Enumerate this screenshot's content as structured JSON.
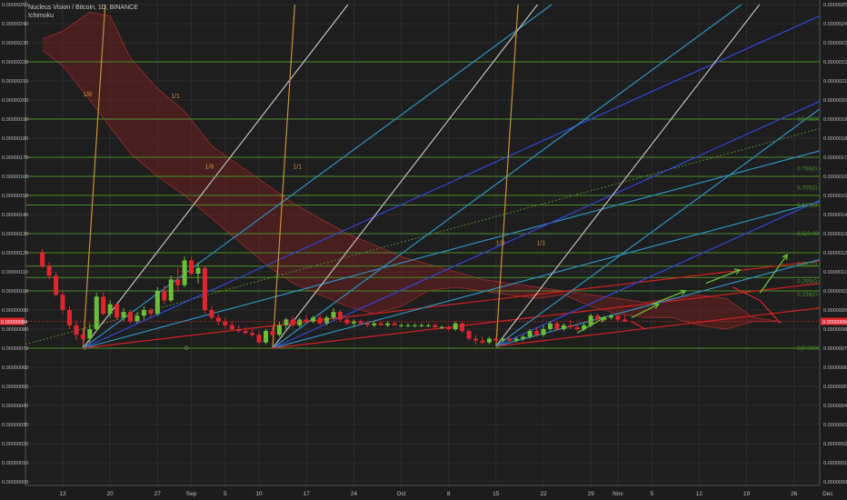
{
  "header": {
    "title": "Nucleus Vision / Bitcoin, 1D, BINANCE",
    "indicator": "Ichimoku"
  },
  "chart_data": {
    "type": "candlestick",
    "ylim": [
      5e-08,
      2.5e-07
    ],
    "y_ticks": [
      "0.00000250",
      "0.00000240",
      "0.00000230",
      "0.00000220",
      "0.00000210",
      "0.00000200",
      "0.00000190",
      "0.00000180",
      "0.00000170",
      "0.00000160",
      "0.00000150",
      "0.00000140",
      "0.00000130",
      "0.00000120",
      "0.00000110",
      "0.00000100",
      "0.00000090",
      "0.00000080",
      "0.00000070",
      "0.00000060",
      "0.00000050",
      "0.00000040",
      "0.00000030",
      "0.00000020",
      "0.00000010",
      "0.00000000"
    ],
    "y_tick_values": [
      250,
      240,
      230,
      220,
      210,
      200,
      190,
      180,
      170,
      160,
      150,
      140,
      130,
      120,
      110,
      100,
      90,
      80,
      70,
      60,
      50,
      40,
      30,
      20,
      10,
      0
    ],
    "price_label": "0.00000084",
    "price_value": 84,
    "x_ticks": [
      "13",
      "20",
      "27",
      "Sep",
      "5",
      "10",
      "17",
      "24",
      "Oct",
      "8",
      "15",
      "22",
      "29",
      "Nov",
      "5",
      "12",
      "19",
      "26",
      "Dec",
      "5"
    ],
    "x_tick_days": [
      0,
      7,
      14,
      19,
      24,
      29,
      36,
      43,
      50,
      57,
      64,
      71,
      78,
      82,
      87,
      94,
      101,
      108,
      113,
      118
    ],
    "horizontal_levels": [
      220,
      190,
      170,
      160,
      150,
      145,
      130,
      120,
      113,
      107,
      100,
      70
    ],
    "fib_labels": [
      {
        "text": "1(0.00000190)",
        "value": 190
      },
      {
        "text": "0.786(0.00",
        "value": 164
      },
      {
        "text": "0.705(0.00",
        "value": 154
      },
      {
        "text": "0.618(0.00",
        "value": 145
      },
      {
        "text": "0.5(0.0000",
        "value": 130
      },
      {
        "text": "0.382(0.00",
        "value": 114
      },
      {
        "text": "0.295(0.00",
        "value": 105
      },
      {
        "text": "0.236(0.00",
        "value": 98
      },
      {
        "text": "0(0.00000",
        "value": 70
      }
    ],
    "fan_labels": [
      {
        "text": "1/8",
        "day": 3,
        "value": 202
      },
      {
        "text": "1/1",
        "day": 16,
        "value": 201
      },
      {
        "text": "1/8",
        "day": 21,
        "value": 164
      },
      {
        "text": "1/1",
        "day": 34,
        "value": 164
      },
      {
        "text": "1/8",
        "day": 64,
        "value": 124
      },
      {
        "text": "1/1",
        "day": 70,
        "value": 124
      }
    ],
    "anchor_labels": [
      {
        "text": "0",
        "day": 3,
        "value": 69
      },
      {
        "text": "0",
        "day": 18,
        "value": 69
      },
      {
        "text": "0",
        "day": 64,
        "value": 70
      }
    ],
    "candles": [
      {
        "d": -3,
        "o": 120,
        "h": 122,
        "l": 112,
        "c": 113
      },
      {
        "d": -2,
        "o": 113,
        "h": 115,
        "l": 106,
        "c": 108
      },
      {
        "d": -1,
        "o": 108,
        "h": 110,
        "l": 97,
        "c": 98
      },
      {
        "d": 0,
        "o": 98,
        "h": 100,
        "l": 88,
        "c": 90
      },
      {
        "d": 1,
        "o": 90,
        "h": 92,
        "l": 80,
        "c": 82
      },
      {
        "d": 2,
        "o": 82,
        "h": 84,
        "l": 74,
        "c": 77
      },
      {
        "d": 3,
        "o": 77,
        "h": 80,
        "l": 72,
        "c": 75
      },
      {
        "d": 4,
        "o": 75,
        "h": 83,
        "l": 73,
        "c": 80
      },
      {
        "d": 5,
        "o": 80,
        "h": 99,
        "l": 79,
        "c": 97
      },
      {
        "d": 6,
        "o": 97,
        "h": 99,
        "l": 87,
        "c": 88
      },
      {
        "d": 7,
        "o": 88,
        "h": 95,
        "l": 86,
        "c": 93
      },
      {
        "d": 8,
        "o": 93,
        "h": 94,
        "l": 85,
        "c": 86
      },
      {
        "d": 9,
        "o": 86,
        "h": 91,
        "l": 84,
        "c": 89
      },
      {
        "d": 10,
        "o": 89,
        "h": 90,
        "l": 83,
        "c": 84
      },
      {
        "d": 11,
        "o": 84,
        "h": 89,
        "l": 83,
        "c": 87
      },
      {
        "d": 12,
        "o": 87,
        "h": 92,
        "l": 85,
        "c": 90
      },
      {
        "d": 13,
        "o": 90,
        "h": 91,
        "l": 86,
        "c": 88
      },
      {
        "d": 14,
        "o": 88,
        "h": 102,
        "l": 87,
        "c": 100
      },
      {
        "d": 15,
        "o": 100,
        "h": 103,
        "l": 93,
        "c": 95
      },
      {
        "d": 16,
        "o": 95,
        "h": 108,
        "l": 94,
        "c": 106
      },
      {
        "d": 17,
        "o": 106,
        "h": 112,
        "l": 100,
        "c": 103
      },
      {
        "d": 18,
        "o": 103,
        "h": 118,
        "l": 102,
        "c": 116
      },
      {
        "d": 19,
        "o": 116,
        "h": 118,
        "l": 108,
        "c": 109
      },
      {
        "d": 20,
        "o": 109,
        "h": 115,
        "l": 104,
        "c": 112
      },
      {
        "d": 21,
        "o": 112,
        "h": 113,
        "l": 88,
        "c": 90
      },
      {
        "d": 22,
        "o": 90,
        "h": 92,
        "l": 85,
        "c": 86
      },
      {
        "d": 23,
        "o": 86,
        "h": 88,
        "l": 82,
        "c": 84
      },
      {
        "d": 24,
        "o": 84,
        "h": 86,
        "l": 80,
        "c": 82
      },
      {
        "d": 25,
        "o": 82,
        "h": 84,
        "l": 79,
        "c": 80
      },
      {
        "d": 26,
        "o": 80,
        "h": 82,
        "l": 78,
        "c": 79
      },
      {
        "d": 27,
        "o": 79,
        "h": 81,
        "l": 77,
        "c": 78
      },
      {
        "d": 28,
        "o": 78,
        "h": 80,
        "l": 76,
        "c": 77
      },
      {
        "d": 29,
        "o": 77,
        "h": 79,
        "l": 72,
        "c": 73
      },
      {
        "d": 30,
        "o": 73,
        "h": 80,
        "l": 72,
        "c": 79
      },
      {
        "d": 31,
        "o": 79,
        "h": 82,
        "l": 76,
        "c": 77
      },
      {
        "d": 32,
        "o": 77,
        "h": 84,
        "l": 76,
        "c": 82
      },
      {
        "d": 33,
        "o": 82,
        "h": 86,
        "l": 80,
        "c": 85
      },
      {
        "d": 34,
        "o": 85,
        "h": 87,
        "l": 81,
        "c": 82
      },
      {
        "d": 35,
        "o": 82,
        "h": 86,
        "l": 81,
        "c": 85
      },
      {
        "d": 36,
        "o": 85,
        "h": 87,
        "l": 83,
        "c": 84
      },
      {
        "d": 37,
        "o": 84,
        "h": 87,
        "l": 83,
        "c": 86
      },
      {
        "d": 38,
        "o": 86,
        "h": 88,
        "l": 82,
        "c": 83
      },
      {
        "d": 39,
        "o": 83,
        "h": 87,
        "l": 82,
        "c": 86
      },
      {
        "d": 40,
        "o": 86,
        "h": 91,
        "l": 85,
        "c": 89
      },
      {
        "d": 41,
        "o": 89,
        "h": 90,
        "l": 84,
        "c": 85
      },
      {
        "d": 42,
        "o": 85,
        "h": 86,
        "l": 82,
        "c": 83
      },
      {
        "d": 43,
        "o": 83,
        "h": 85,
        "l": 81,
        "c": 84
      },
      {
        "d": 44,
        "o": 84,
        "h": 85,
        "l": 82,
        "c": 83
      },
      {
        "d": 45,
        "o": 83,
        "h": 84,
        "l": 81,
        "c": 82
      },
      {
        "d": 46,
        "o": 82,
        "h": 84,
        "l": 81,
        "c": 83
      },
      {
        "d": 47,
        "o": 83,
        "h": 84,
        "l": 82,
        "c": 82
      },
      {
        "d": 48,
        "o": 82,
        "h": 84,
        "l": 81,
        "c": 83
      },
      {
        "d": 49,
        "o": 83,
        "h": 84,
        "l": 82,
        "c": 82
      },
      {
        "d": 50,
        "o": 82,
        "h": 83,
        "l": 81,
        "c": 82
      },
      {
        "d": 51,
        "o": 82,
        "h": 83,
        "l": 81,
        "c": 82
      },
      {
        "d": 52,
        "o": 82,
        "h": 83,
        "l": 81,
        "c": 82
      },
      {
        "d": 53,
        "o": 82,
        "h": 83,
        "l": 81,
        "c": 82
      },
      {
        "d": 54,
        "o": 82,
        "h": 83,
        "l": 81,
        "c": 82
      },
      {
        "d": 55,
        "o": 82,
        "h": 83,
        "l": 80,
        "c": 81
      },
      {
        "d": 56,
        "o": 81,
        "h": 82,
        "l": 80,
        "c": 81
      },
      {
        "d": 57,
        "o": 81,
        "h": 82,
        "l": 79,
        "c": 80
      },
      {
        "d": 58,
        "o": 80,
        "h": 84,
        "l": 79,
        "c": 83
      },
      {
        "d": 59,
        "o": 83,
        "h": 84,
        "l": 78,
        "c": 79
      },
      {
        "d": 60,
        "o": 79,
        "h": 80,
        "l": 74,
        "c": 75
      },
      {
        "d": 61,
        "o": 75,
        "h": 77,
        "l": 72,
        "c": 74
      },
      {
        "d": 62,
        "o": 74,
        "h": 76,
        "l": 72,
        "c": 73
      },
      {
        "d": 63,
        "o": 73,
        "h": 76,
        "l": 72,
        "c": 75
      },
      {
        "d": 64,
        "o": 75,
        "h": 76,
        "l": 73,
        "c": 74
      },
      {
        "d": 65,
        "o": 74,
        "h": 76,
        "l": 73,
        "c": 75
      },
      {
        "d": 66,
        "o": 75,
        "h": 76,
        "l": 73,
        "c": 74
      },
      {
        "d": 67,
        "o": 74,
        "h": 76,
        "l": 73,
        "c": 75
      },
      {
        "d": 68,
        "o": 75,
        "h": 77,
        "l": 74,
        "c": 76
      },
      {
        "d": 69,
        "o": 76,
        "h": 80,
        "l": 75,
        "c": 79
      },
      {
        "d": 70,
        "o": 79,
        "h": 81,
        "l": 76,
        "c": 77
      },
      {
        "d": 71,
        "o": 77,
        "h": 82,
        "l": 76,
        "c": 80
      },
      {
        "d": 72,
        "o": 80,
        "h": 84,
        "l": 79,
        "c": 83
      },
      {
        "d": 73,
        "o": 83,
        "h": 84,
        "l": 79,
        "c": 80
      },
      {
        "d": 74,
        "o": 80,
        "h": 83,
        "l": 79,
        "c": 82
      },
      {
        "d": 75,
        "o": 82,
        "h": 85,
        "l": 80,
        "c": 81
      },
      {
        "d": 76,
        "o": 81,
        "h": 83,
        "l": 79,
        "c": 80
      },
      {
        "d": 77,
        "o": 80,
        "h": 83,
        "l": 79,
        "c": 82
      },
      {
        "d": 78,
        "o": 82,
        "h": 88,
        "l": 81,
        "c": 87
      },
      {
        "d": 79,
        "o": 87,
        "h": 88,
        "l": 84,
        "c": 85
      },
      {
        "d": 80,
        "o": 85,
        "h": 87,
        "l": 84,
        "c": 86
      },
      {
        "d": 81,
        "o": 86,
        "h": 88,
        "l": 85,
        "c": 87
      },
      {
        "d": 82,
        "o": 87,
        "h": 88,
        "l": 84,
        "c": 85
      },
      {
        "d": 83,
        "o": 85,
        "h": 88,
        "l": 84,
        "c": 84
      }
    ],
    "ichimoku_cloud": [
      {
        "d": -3,
        "a": 232,
        "b": 226
      },
      {
        "d": 0,
        "a": 236,
        "b": 218
      },
      {
        "d": 4,
        "a": 246,
        "b": 200
      },
      {
        "d": 7,
        "a": 244,
        "b": 186
      },
      {
        "d": 10,
        "a": 222,
        "b": 172
      },
      {
        "d": 14,
        "a": 206,
        "b": 160
      },
      {
        "d": 18,
        "a": 194,
        "b": 150
      },
      {
        "d": 22,
        "a": 176,
        "b": 138
      },
      {
        "d": 26,
        "a": 166,
        "b": 126
      },
      {
        "d": 30,
        "a": 156,
        "b": 114
      },
      {
        "d": 34,
        "a": 146,
        "b": 104
      },
      {
        "d": 38,
        "a": 138,
        "b": 98
      },
      {
        "d": 42,
        "a": 130,
        "b": 92
      },
      {
        "d": 46,
        "a": 124,
        "b": 88
      },
      {
        "d": 50,
        "a": 118,
        "b": 92
      },
      {
        "d": 54,
        "a": 114,
        "b": 100
      },
      {
        "d": 58,
        "a": 110,
        "b": 102
      },
      {
        "d": 62,
        "a": 106,
        "b": 100
      },
      {
        "d": 66,
        "a": 104,
        "b": 98
      },
      {
        "d": 70,
        "a": 102,
        "b": 96
      },
      {
        "d": 74,
        "a": 100,
        "b": 98
      },
      {
        "d": 78,
        "a": 98,
        "b": 92
      },
      {
        "d": 82,
        "a": 96,
        "b": 88
      },
      {
        "d": 86,
        "a": 94,
        "b": 86
      },
      {
        "d": 90,
        "a": 96,
        "b": 86
      },
      {
        "d": 94,
        "a": 98,
        "b": 82
      },
      {
        "d": 98,
        "a": 96,
        "b": 80
      },
      {
        "d": 102,
        "a": 86,
        "b": 84
      },
      {
        "d": 106,
        "a": 84,
        "b": 84
      }
    ]
  }
}
